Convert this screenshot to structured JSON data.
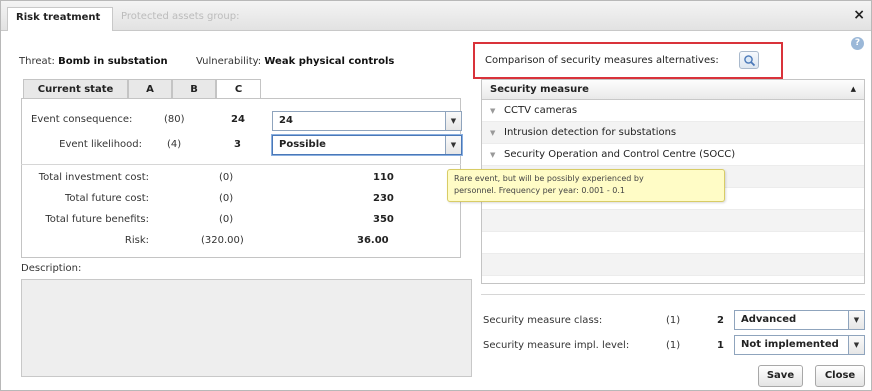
{
  "window": {
    "title": "Risk treatment",
    "secondary_tab": "Protected assets group:",
    "close_glyph": "×",
    "help_glyph": "?"
  },
  "threat": {
    "label": "Threat:",
    "value": "Bomb in substation"
  },
  "vulnerability": {
    "label": "Vulnerability:",
    "value": "Weak physical controls"
  },
  "comparison": {
    "label": "Comparison of security measures alternatives:",
    "icon": "compare-search-icon"
  },
  "tabs": [
    {
      "label": "Current state",
      "active": false
    },
    {
      "label": "A",
      "active": false
    },
    {
      "label": "B",
      "active": false
    },
    {
      "label": "C",
      "active": true
    }
  ],
  "event": {
    "consequence": {
      "label": "Event consequence:",
      "prev": "(80)",
      "current": "24",
      "select": "24"
    },
    "likelihood": {
      "label": "Event likelihood:",
      "prev": "(4)",
      "current": "3",
      "select": "Possible"
    }
  },
  "costs": [
    {
      "label": "Total investment cost:",
      "prev": "(0)",
      "current": "110"
    },
    {
      "label": "Total future cost:",
      "prev": "(0)",
      "current": "230"
    },
    {
      "label": "Total future benefits:",
      "prev": "(0)",
      "current": "350"
    },
    {
      "label": "Risk:",
      "prev": "(320.00)",
      "current": "36.00"
    }
  ],
  "description": {
    "label": "Description:",
    "value": ""
  },
  "measures_table": {
    "header": "Security measure",
    "sort_glyph": "▲",
    "rows": [
      "CCTV cameras",
      "Intrusion detection for substations",
      "Security Operation and Control Centre (SOCC)"
    ]
  },
  "tooltip": {
    "line1": "Rare event, but will be possibly experienced by",
    "line2": "personnel. Frequency per year: 0.001 - 0.1"
  },
  "measure_class": {
    "label": "Security measure class:",
    "prev": "(1)",
    "current": "2",
    "select": "Advanced"
  },
  "measure_impl": {
    "label": "Security measure impl. level:",
    "prev": "(1)",
    "current": "1",
    "select": "Not implemented"
  },
  "buttons": {
    "save": "Save",
    "close": "Close"
  },
  "colors": {
    "highlight": "#d9323a",
    "tooltip_bg": "#fffcc6",
    "select_border": "#8fa4bd"
  }
}
